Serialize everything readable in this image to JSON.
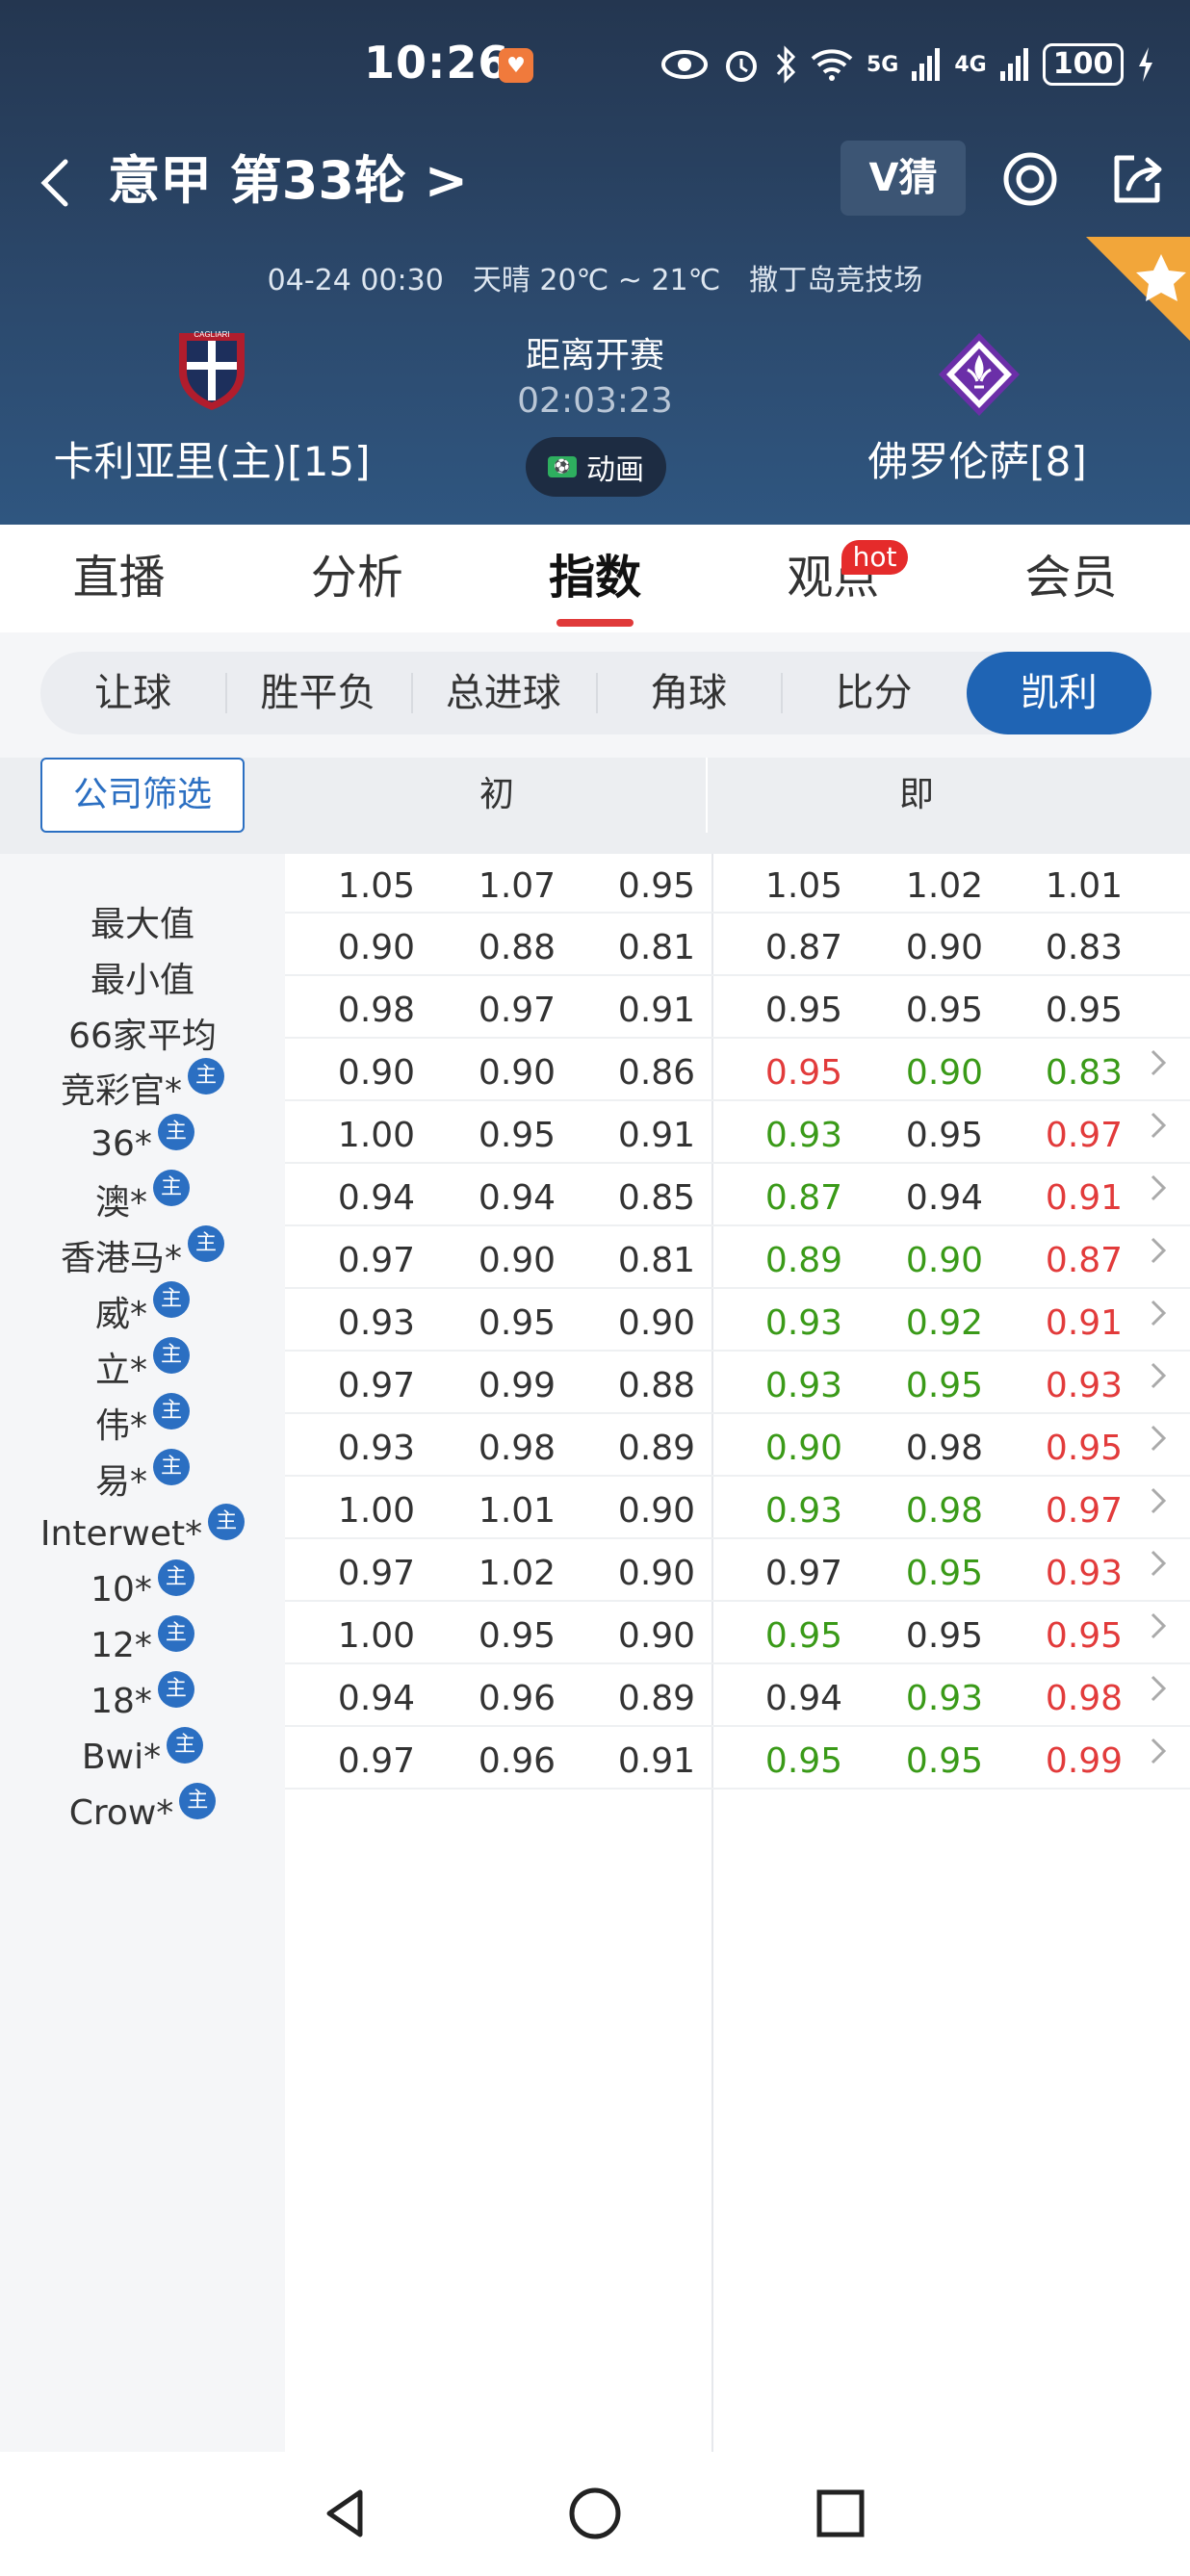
{
  "status_bar": {
    "time": "10:26",
    "network_labels": [
      "5G",
      "4G"
    ],
    "battery": "100"
  },
  "header": {
    "title": "意甲 第33轮 >",
    "v_guess_label": "V猜",
    "match_info": "04-24 00:30　天晴 20℃ ~ 21℃　撒丁岛竞技场",
    "home_team": "卡利亚里(主)[15]",
    "away_team": "佛罗伦萨[8]",
    "home_logo_text": "CAGLIARI",
    "countdown_label": "距离开赛",
    "countdown": "02:03:23",
    "animation_label": "动画"
  },
  "tabs": [
    {
      "label": "直播",
      "active": false
    },
    {
      "label": "分析",
      "active": false
    },
    {
      "label": "指数",
      "active": true
    },
    {
      "label": "观点",
      "active": false,
      "badge": "hot"
    },
    {
      "label": "会员",
      "active": false
    }
  ],
  "sub_tabs": [
    {
      "label": "让球",
      "active": false
    },
    {
      "label": "胜平负",
      "active": false
    },
    {
      "label": "总进球",
      "active": false
    },
    {
      "label": "角球",
      "active": false
    },
    {
      "label": "比分",
      "active": false
    },
    {
      "label": "凯利",
      "active": true
    }
  ],
  "table": {
    "filter_label": "公司筛选",
    "col_initial": "初",
    "col_current": "即",
    "zhu_label": "主",
    "rows": [
      {
        "name": "最大值",
        "zhu": false,
        "init": [
          "1.05",
          "1.07",
          "0.95"
        ],
        "now": [
          "1.05",
          "1.02",
          "1.01"
        ],
        "colors": [
          "",
          "",
          ""
        ],
        "arrow": false
      },
      {
        "name": "最小值",
        "zhu": false,
        "init": [
          "0.90",
          "0.88",
          "0.81"
        ],
        "now": [
          "0.87",
          "0.90",
          "0.83"
        ],
        "colors": [
          "",
          "",
          ""
        ],
        "arrow": false
      },
      {
        "name": "66家平均",
        "zhu": false,
        "init": [
          "0.98",
          "0.97",
          "0.91"
        ],
        "now": [
          "0.95",
          "0.95",
          "0.95"
        ],
        "colors": [
          "",
          "",
          ""
        ],
        "arrow": false
      },
      {
        "name": "竞彩官*",
        "zhu": true,
        "init": [
          "0.90",
          "0.90",
          "0.86"
        ],
        "now": [
          "0.95",
          "0.90",
          "0.83"
        ],
        "colors": [
          "red",
          "green",
          "green"
        ],
        "arrow": true
      },
      {
        "name": "36*",
        "zhu": true,
        "init": [
          "1.00",
          "0.95",
          "0.91"
        ],
        "now": [
          "0.93",
          "0.95",
          "0.97"
        ],
        "colors": [
          "green",
          "",
          "red"
        ],
        "arrow": true
      },
      {
        "name": "澳*",
        "zhu": true,
        "init": [
          "0.94",
          "0.94",
          "0.85"
        ],
        "now": [
          "0.87",
          "0.94",
          "0.91"
        ],
        "colors": [
          "green",
          "",
          "red"
        ],
        "arrow": true
      },
      {
        "name": "香港马*",
        "zhu": true,
        "init": [
          "0.97",
          "0.90",
          "0.81"
        ],
        "now": [
          "0.89",
          "0.90",
          "0.87"
        ],
        "colors": [
          "green",
          "green",
          "red"
        ],
        "arrow": true
      },
      {
        "name": "威*",
        "zhu": true,
        "init": [
          "0.93",
          "0.95",
          "0.90"
        ],
        "now": [
          "0.93",
          "0.92",
          "0.91"
        ],
        "colors": [
          "green",
          "green",
          "red"
        ],
        "arrow": true
      },
      {
        "name": "立*",
        "zhu": true,
        "init": [
          "0.97",
          "0.99",
          "0.88"
        ],
        "now": [
          "0.93",
          "0.95",
          "0.93"
        ],
        "colors": [
          "green",
          "green",
          "red"
        ],
        "arrow": true
      },
      {
        "name": "伟*",
        "zhu": true,
        "init": [
          "0.93",
          "0.98",
          "0.89"
        ],
        "now": [
          "0.90",
          "0.98",
          "0.95"
        ],
        "colors": [
          "green",
          "",
          "red"
        ],
        "arrow": true
      },
      {
        "name": "易*",
        "zhu": true,
        "init": [
          "1.00",
          "1.01",
          "0.90"
        ],
        "now": [
          "0.93",
          "0.98",
          "0.97"
        ],
        "colors": [
          "green",
          "green",
          "red"
        ],
        "arrow": true
      },
      {
        "name": "Interwet*",
        "zhu": true,
        "init": [
          "0.97",
          "1.02",
          "0.90"
        ],
        "now": [
          "0.97",
          "0.95",
          "0.93"
        ],
        "colors": [
          "",
          "green",
          "red"
        ],
        "arrow": true
      },
      {
        "name": "10*",
        "zhu": true,
        "init": [
          "1.00",
          "0.95",
          "0.90"
        ],
        "now": [
          "0.95",
          "0.95",
          "0.95"
        ],
        "colors": [
          "green",
          "",
          "red"
        ],
        "arrow": true
      },
      {
        "name": "12*",
        "zhu": true,
        "init": [
          "0.94",
          "0.96",
          "0.89"
        ],
        "now": [
          "0.94",
          "0.93",
          "0.98"
        ],
        "colors": [
          "",
          "green",
          "red"
        ],
        "arrow": true
      },
      {
        "name": "18*",
        "zhu": true,
        "init": [
          "0.97",
          "0.96",
          "0.91"
        ],
        "now": [
          "0.95",
          "0.95",
          "0.99"
        ],
        "colors": [
          "green",
          "green",
          "red"
        ],
        "arrow": true
      },
      {
        "name": "Bwi*",
        "zhu": true,
        "init": [],
        "now": [],
        "colors": [],
        "arrow": false
      },
      {
        "name": "Crow*",
        "zhu": true,
        "init": [],
        "now": [],
        "colors": [],
        "arrow": false
      }
    ]
  }
}
